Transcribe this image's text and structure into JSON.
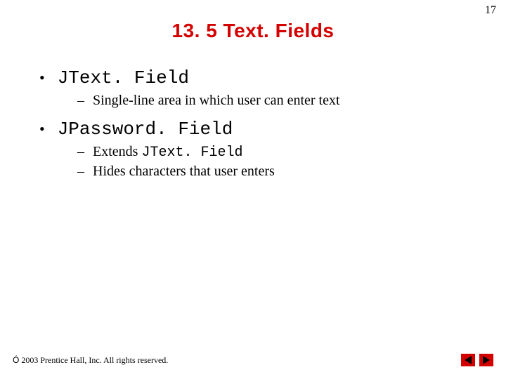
{
  "pageNumber": "17",
  "title": "13. 5  Text. Fields",
  "bullets": {
    "b1": "JText. Field",
    "b1_1": "Single-line area in which user can enter text",
    "b2": "JPassword. Field",
    "b2_1_prefix": "Extends ",
    "b2_1_mono": "JText. Field",
    "b2_2": "Hides characters that user enters"
  },
  "footer": {
    "copyright": "2003 Prentice Hall, Inc. All rights reserved."
  }
}
